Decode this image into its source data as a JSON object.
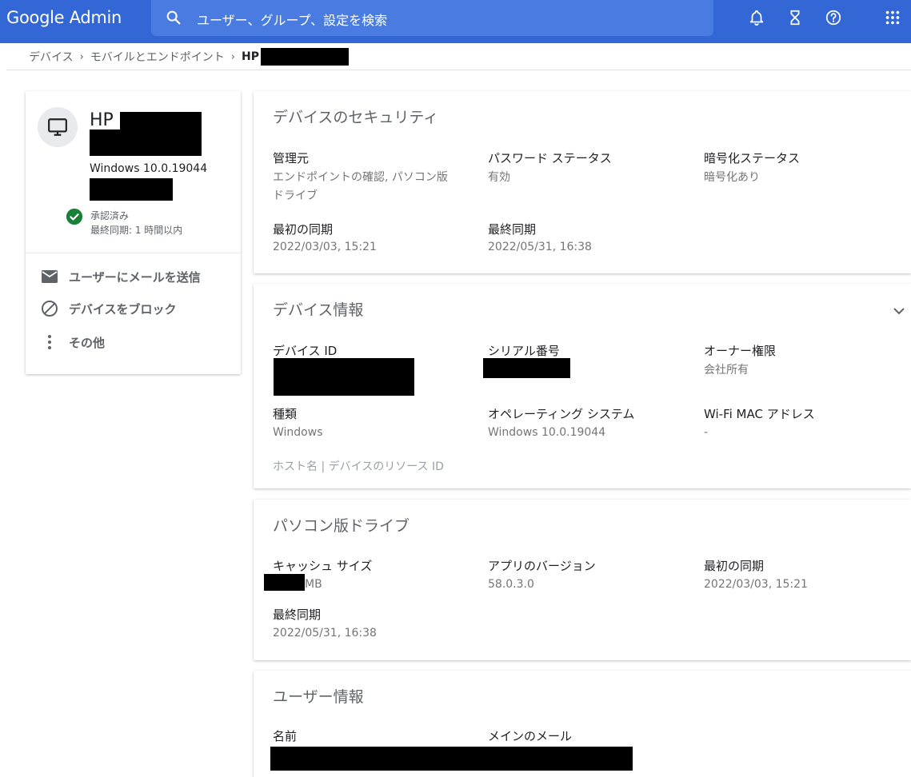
{
  "header": {
    "logo": "Google Admin",
    "search_placeholder": "ユーザー、グループ、設定を検索",
    "icons": [
      "search-icon",
      "bell-icon",
      "hourglass-icon",
      "help-icon",
      "apps-grid-icon"
    ]
  },
  "breadcrumb": {
    "items": [
      "デバイス",
      "モバイルとエンドポイント"
    ],
    "current": "HP"
  },
  "sidebar": {
    "device_name": "HP",
    "os": "Windows 10.0.19044",
    "status": "承認済み",
    "last_sync": "最終同期: 1 時間以内",
    "actions": [
      {
        "label": "ユーザーにメールを送信",
        "icon": "mail-icon"
      },
      {
        "label": "デバイスをブロック",
        "icon": "block-icon"
      },
      {
        "label": "その他",
        "icon": "more-vert-icon"
      }
    ]
  },
  "security": {
    "title": "デバイスのセキュリティ",
    "managed_by_label": "管理元",
    "managed_by_value": "エンドポイントの確認, パソコン版ドライブ",
    "password_label": "パスワード ステータス",
    "password_value": "有効",
    "encryption_label": "暗号化ステータス",
    "encryption_value": "暗号化あり",
    "first_sync_label": "最初の同期",
    "first_sync_value": "2022/03/03, 15:21",
    "last_sync_label": "最終同期",
    "last_sync_value": "2022/05/31, 16:38"
  },
  "device_info": {
    "title": "デバイス情報",
    "device_id_label": "デバイス ID",
    "serial_label": "シリアル番号",
    "owner_label": "オーナー権限",
    "owner_value": "会社所有",
    "type_label": "種類",
    "type_value": "Windows",
    "os_label": "オペレーティング システム",
    "os_value": "Windows 10.0.19044",
    "wifi_label": "Wi-Fi MAC アドレス",
    "wifi_value": "-",
    "footer": "ホスト名 | デバイスのリソース ID"
  },
  "drive": {
    "title": "パソコン版ドライブ",
    "cache_label": "キャッシュ サイズ",
    "cache_unit": "MB",
    "app_version_label": "アプリのバージョン",
    "app_version_value": "58.0.3.0",
    "first_sync_label": "最初の同期",
    "first_sync_value": "2022/03/03, 15:21",
    "last_sync_label": "最終同期",
    "last_sync_value": "2022/05/31, 16:38"
  },
  "user_info": {
    "title": "ユーザー情報",
    "name_label": "名前",
    "email_label": "メインのメール"
  },
  "colors": {
    "header_bg": "#3367d6",
    "search_bg": "#4a7be0",
    "status_green": "#188038"
  }
}
